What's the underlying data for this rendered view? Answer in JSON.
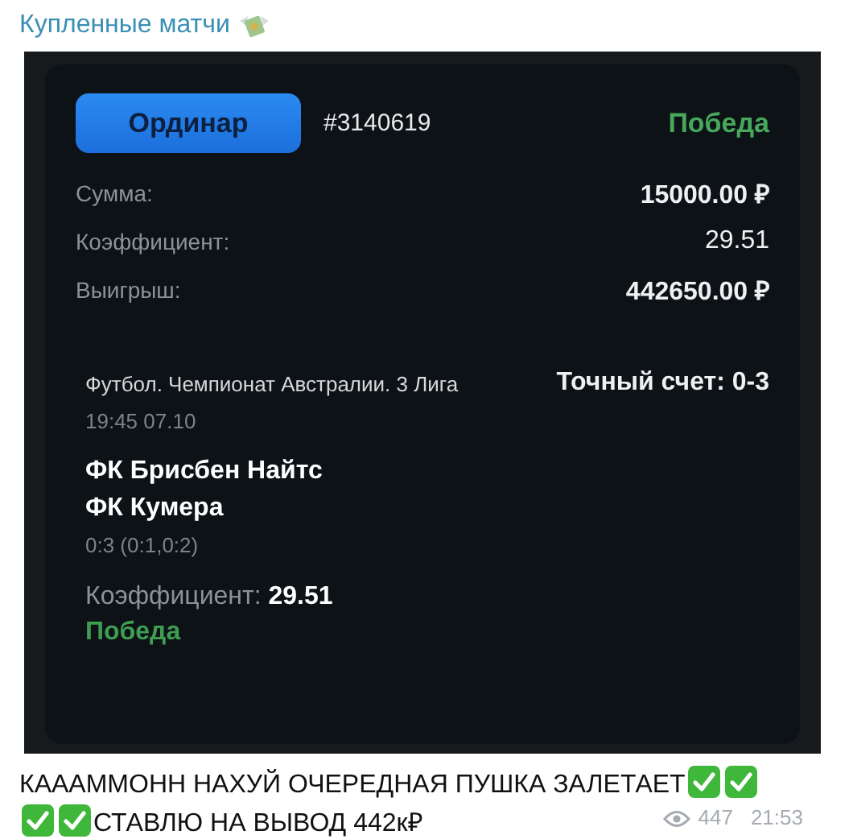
{
  "channel": {
    "title": "Купленные матчи"
  },
  "bet": {
    "type_button": "Ординар",
    "number": "#3140619",
    "status": "Победа",
    "rows": [
      {
        "label": "Сумма:",
        "value": "15000.00 ₽",
        "bold": true
      },
      {
        "label": "Коэффициент:",
        "value": "29.51",
        "bold": false
      },
      {
        "label": "Выигрыш:",
        "value": "442650.00 ₽",
        "bold": true
      }
    ],
    "event": {
      "league": "Футбол. Чемпионат Австралии. 3 Лига",
      "time": "19:45 07.10",
      "market": "Точный счет: 0-3",
      "teams": [
        "ФК Брисбен Найтс",
        "ФК Кумера"
      ],
      "score": "0:3 (0:1,0:2)",
      "odds": "Коэффициент: **29.51**",
      "result": "Победа"
    }
  },
  "message": {
    "parts": [
      {
        "kind": "text",
        "text": "КАААММОНН НАХУЙ ОЧЕРЕДНАЯ ПУШКА ЗАЛЕТАЕТ"
      },
      {
        "kind": "check"
      },
      {
        "kind": "check"
      },
      {
        "kind": "check"
      },
      {
        "kind": "check"
      },
      {
        "kind": "text",
        "text": "СТАВЛЮ НА ВЫВОД 442к₽"
      }
    ],
    "views": "447",
    "time": "21:53"
  }
}
